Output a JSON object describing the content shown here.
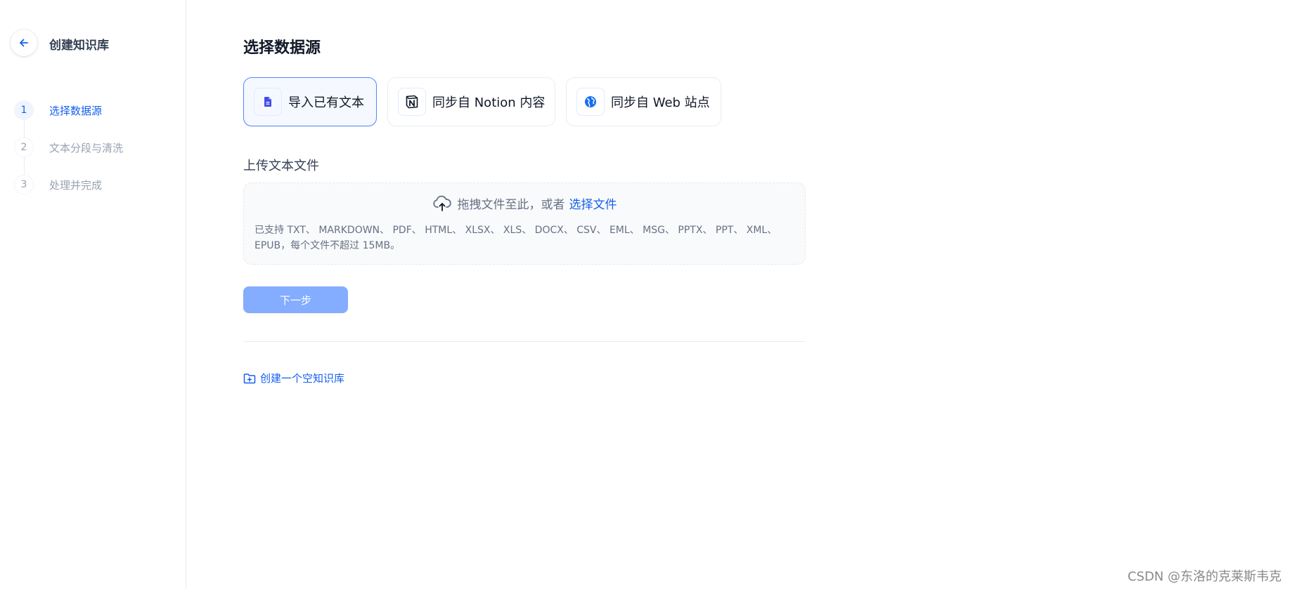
{
  "sidebar": {
    "back_icon": "arrow-left-icon",
    "title": "创建知识库",
    "steps": [
      {
        "num": "1",
        "label": "选择数据源",
        "active": true
      },
      {
        "num": "2",
        "label": "文本分段与清洗",
        "active": false
      },
      {
        "num": "3",
        "label": "处理并完成",
        "active": false
      }
    ]
  },
  "main": {
    "title": "选择数据源",
    "sources": [
      {
        "label": "导入已有文本",
        "icon": "document-icon",
        "selected": true
      },
      {
        "label": "同步自 Notion 内容",
        "icon": "notion-icon",
        "selected": false
      },
      {
        "label": "同步自 Web 站点",
        "icon": "globe-icon",
        "selected": false
      }
    ],
    "upload": {
      "title": "上传文本文件",
      "prompt": "拖拽文件至此，或者",
      "link": "选择文件",
      "hint": "已支持 TXT、 MARKDOWN、 PDF、 HTML、 XLSX、 XLS、 DOCX、 CSV、 EML、 MSG、 PPTX、 PPT、 XML、 EPUB，每个文件不超过 15MB。"
    },
    "next_label": "下一步",
    "create_empty_label": "创建一个空知识库"
  },
  "watermark": "CSDN @东洛的克莱斯韦克",
  "colors": {
    "accent": "#155eef",
    "button_disabled": "#84adff",
    "muted_text": "#98a2b3"
  }
}
